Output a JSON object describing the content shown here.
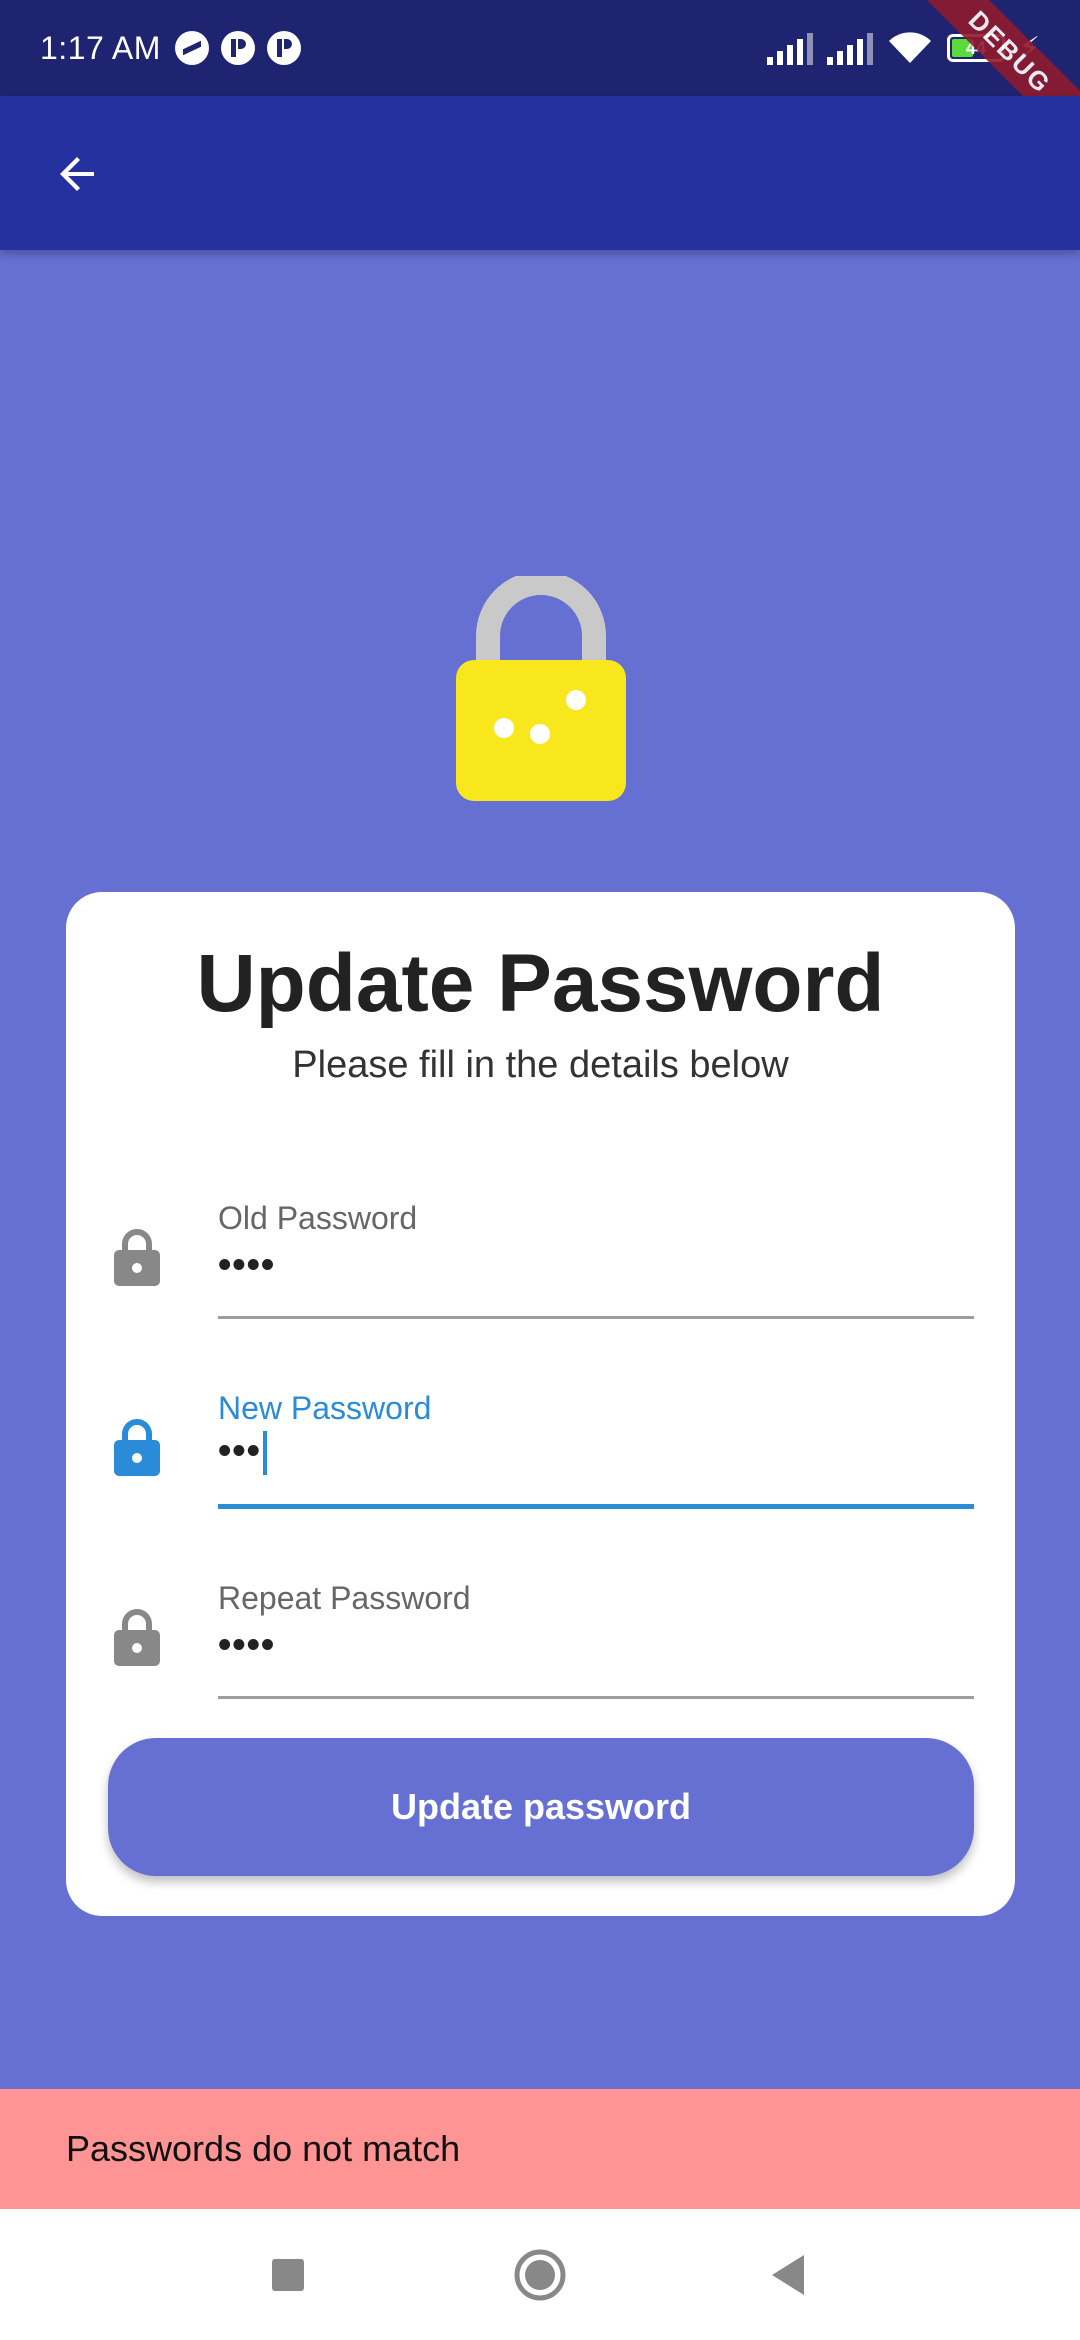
{
  "status_bar": {
    "time": "1:17 AM",
    "battery_level": "44",
    "debug_label": "DEBUG"
  },
  "colors": {
    "background": "#6670d3",
    "status_bar": "#1e2470",
    "app_bar": "#2631a0",
    "lock_body": "#f8e71c",
    "lock_shackle": "#c9c9c9",
    "focused_field": "#2a8bd8",
    "error_snackbar": "#ff9494"
  },
  "app_bar": {
    "back_icon": "arrow-left-icon"
  },
  "card": {
    "title": "Update Password",
    "subtitle": "Please fill in the details below",
    "fields": [
      {
        "label": "Old Password",
        "value": "••••",
        "icon": "lock-icon",
        "focused": false
      },
      {
        "label": "New Password",
        "value": "•••",
        "icon": "lock-icon",
        "focused": true
      },
      {
        "label": "Repeat Password",
        "value": "••••",
        "icon": "lock-icon",
        "focused": false
      }
    ],
    "submit_label": "Update password"
  },
  "snackbar": {
    "message": "Passwords do not match"
  },
  "nav_bar": {
    "recents_icon": "square-icon",
    "home_icon": "circle-icon",
    "back_icon": "triangle-back-icon"
  }
}
